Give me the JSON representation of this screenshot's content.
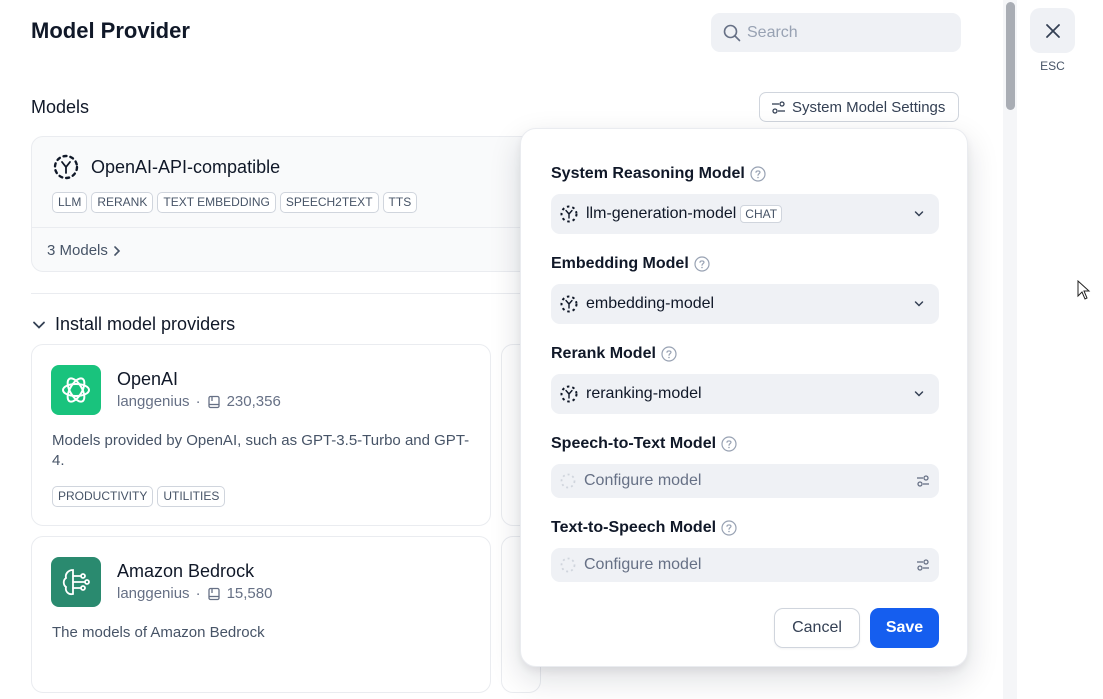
{
  "header": {
    "title": "Model Provider",
    "search_placeholder": "Search",
    "esc_label": "ESC"
  },
  "models_section": {
    "title": "Models",
    "system_settings_label": "System Model Settings",
    "provider": {
      "name": "OpenAI-API-compatible",
      "tags": [
        "LLM",
        "RERANK",
        "TEXT EMBEDDING",
        "SPEECH2TEXT",
        "TTS"
      ],
      "models_link": "3 Models"
    }
  },
  "install_section": {
    "title": "Install model providers",
    "cards": [
      {
        "name": "OpenAI",
        "author": "langgenius",
        "installs": "230,356",
        "description": "Models provided by OpenAI, such as GPT-3.5-Turbo and GPT-4.",
        "tags": [
          "PRODUCTIVITY",
          "UTILITIES"
        ],
        "logo_color": "#19c37d"
      },
      {
        "name": "Amazon Bedrock",
        "author": "langgenius",
        "installs": "15,580",
        "description": "The models of Amazon Bedrock",
        "tags": [],
        "logo_color": "#2a8a6f"
      }
    ]
  },
  "modal": {
    "fields": [
      {
        "label": "System Reasoning Model",
        "value": "llm-generation-model",
        "badge": "CHAT"
      },
      {
        "label": "Embedding Model",
        "value": "embedding-model"
      },
      {
        "label": "Rerank Model",
        "value": "reranking-model"
      },
      {
        "label": "Speech-to-Text Model",
        "placeholder": "Configure model"
      },
      {
        "label": "Text-to-Speech Model",
        "placeholder": "Configure model"
      }
    ],
    "cancel_label": "Cancel",
    "save_label": "Save"
  },
  "colors": {
    "accent": "#155eef",
    "surface": "#eff1f5",
    "border": "#d0d5dd"
  }
}
